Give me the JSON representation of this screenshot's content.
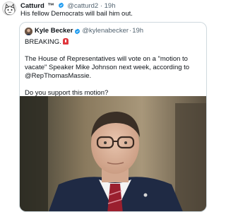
{
  "outer_post": {
    "author_name": "Catturd",
    "author_suffix": "™",
    "handle": "@catturd2",
    "separator": "·",
    "time": "19h",
    "text": "His fellow Democrats will bail him out."
  },
  "quoted_post": {
    "author_name": "Kyle Becker",
    "handle": "@kylenabecker",
    "separator": "·",
    "time": "19h",
    "breaking_label": "BREAKING.",
    "paragraph_1": "The House of Representatives will vote on a \"motion to vacate\" Speaker Mike Johnson next week, according to @RepThomasMassie.",
    "paragraph_2": "Do you support this motion?"
  },
  "colors": {
    "verified_badge": "#1d9bf0",
    "muted_text": "#536471",
    "border": "#cfd9de",
    "siren": "#e0383e"
  },
  "icons": {
    "verified": "verified-badge-icon",
    "siren": "siren-emoji-icon"
  }
}
